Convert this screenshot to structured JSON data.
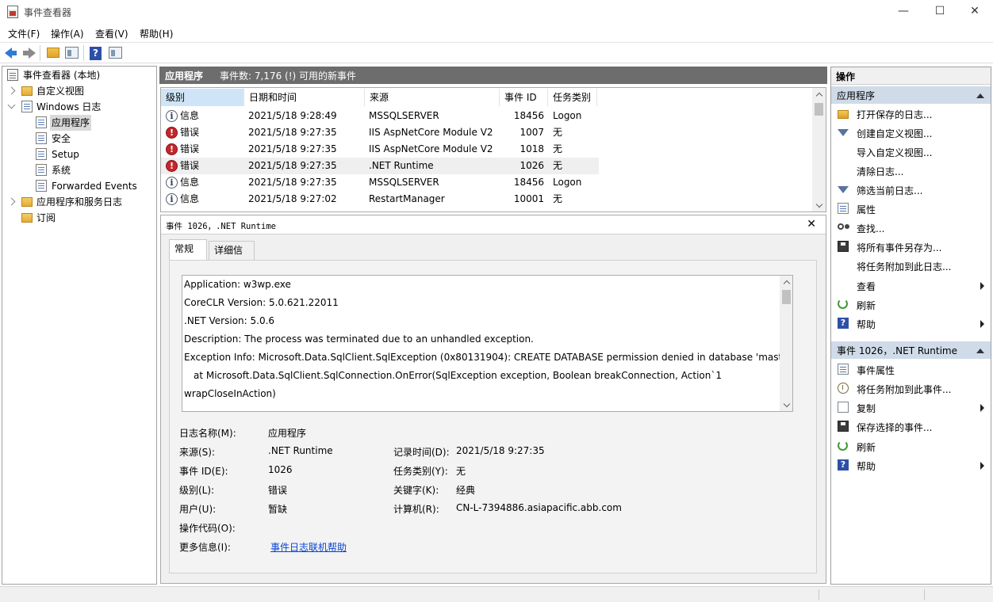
{
  "window": {
    "title": "事件查看器",
    "min": "—",
    "max": "☐",
    "close": "✕"
  },
  "menu": [
    "文件(F)",
    "操作(A)",
    "查看(V)",
    "帮助(H)"
  ],
  "toolbar": {
    "help_glyph": "?"
  },
  "tree": {
    "root": "事件查看器 (本地)",
    "custom_views": "自定义视图",
    "windows_logs": "Windows 日志",
    "logs": [
      "应用程序",
      "安全",
      "Setup",
      "系统",
      "Forwarded Events"
    ],
    "apps_services": "应用程序和服务日志",
    "subscriptions": "订阅"
  },
  "center": {
    "log_name": "应用程序",
    "event_count": "事件数: 7,176 (!) 可用的新事件"
  },
  "grid": {
    "columns": [
      "级别",
      "日期和时间",
      "来源",
      "事件 ID",
      "任务类别"
    ],
    "rows": [
      {
        "level": "信息",
        "type": "info",
        "date": "2021/5/18 9:28:49",
        "source": "MSSQLSERVER",
        "id": "18456",
        "task": "Logon"
      },
      {
        "level": "错误",
        "type": "err",
        "date": "2021/5/18 9:27:35",
        "source": "IIS AspNetCore Module V2",
        "id": "1007",
        "task": "无"
      },
      {
        "level": "错误",
        "type": "err",
        "date": "2021/5/18 9:27:35",
        "source": "IIS AspNetCore Module V2",
        "id": "1018",
        "task": "无"
      },
      {
        "level": "错误",
        "type": "err",
        "date": "2021/5/18 9:27:35",
        "source": ".NET Runtime",
        "id": "1026",
        "task": "无"
      },
      {
        "level": "信息",
        "type": "info",
        "date": "2021/5/18 9:27:35",
        "source": "MSSQLSERVER",
        "id": "18456",
        "task": "Logon"
      },
      {
        "level": "信息",
        "type": "info",
        "date": "2021/5/18 9:27:02",
        "source": "RestartManager",
        "id": "10001",
        "task": "无"
      }
    ]
  },
  "detail": {
    "title": "事件 1026，.NET Runtime",
    "close": "✕",
    "tabs": [
      "常规",
      "详细信息"
    ],
    "description": [
      "Application: w3wp.exe",
      "CoreCLR Version: 5.0.621.22011",
      ".NET Version: 5.0.6",
      "Description: The process was terminated due to an unhandled exception.",
      "Exception Info: Microsoft.Data.SqlClient.SqlException (0x80131904): CREATE DATABASE permission denied in database 'master'.",
      "   at Microsoft.Data.SqlClient.SqlConnection.OnError(SqlException exception, Boolean breakConnection, Action`1",
      "wrapCloseInAction)"
    ],
    "props": {
      "log_label": "日志名称(M):",
      "log_value": "应用程序",
      "source_label": "来源(S):",
      "source_value": ".NET Runtime",
      "logged_label": "记录时间(D):",
      "logged_value": "2021/5/18 9:27:35",
      "id_label": "事件 ID(E):",
      "id_value": "1026",
      "task_label": "任务类别(Y):",
      "task_value": "无",
      "level_label": "级别(L):",
      "level_value": "错误",
      "keywords_label": "关键字(K):",
      "keywords_value": "经典",
      "user_label": "用户(U):",
      "user_value": "暂缺",
      "computer_label": "计算机(R):",
      "computer_value": "CN-L-7394886.asiapacific.abb.com",
      "opcode_label": "操作代码(O):",
      "more_label": "更多信息(I):",
      "more_link": "事件日志联机帮助"
    }
  },
  "actions": {
    "title": "操作",
    "section1": "应用程序",
    "items1": [
      "打开保存的日志...",
      "创建自定义视图...",
      "导入自定义视图...",
      "清除日志...",
      "筛选当前日志...",
      "属性",
      "查找...",
      "将所有事件另存为...",
      "将任务附加到此日志...",
      "查看",
      "刷新",
      "帮助"
    ],
    "section2": "事件 1026，.NET Runtime",
    "items2": [
      "事件属性",
      "将任务附加到此事件...",
      "复制",
      "保存选择的事件...",
      "刷新",
      "帮助"
    ],
    "help_glyph": "?"
  },
  "colors": {
    "accent": "#cfe5f7",
    "section": "#cfdbe8",
    "header": "#6d6d6d",
    "error": "#c1272d",
    "link": "#0645d4"
  }
}
